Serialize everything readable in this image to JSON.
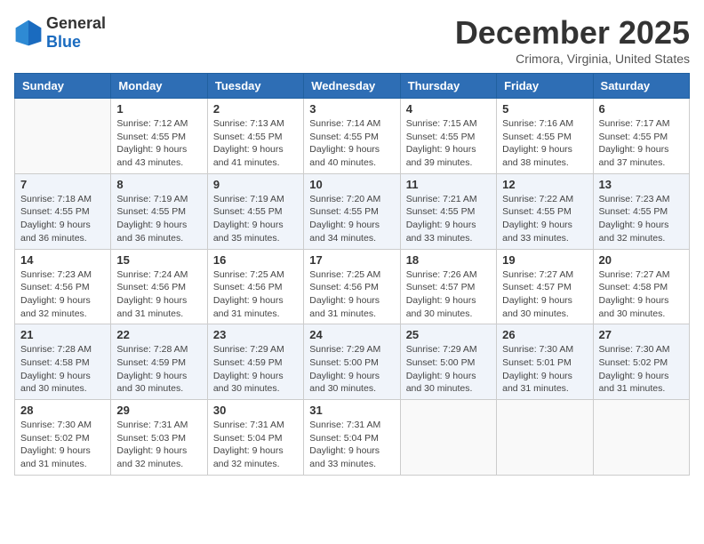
{
  "logo": {
    "text_general": "General",
    "text_blue": "Blue"
  },
  "header": {
    "month_title": "December 2025",
    "location": "Crimora, Virginia, United States"
  },
  "weekdays": [
    "Sunday",
    "Monday",
    "Tuesday",
    "Wednesday",
    "Thursday",
    "Friday",
    "Saturday"
  ],
  "weeks": [
    [
      {
        "day": "",
        "sunrise": "",
        "sunset": "",
        "daylight": ""
      },
      {
        "day": "1",
        "sunrise": "Sunrise: 7:12 AM",
        "sunset": "Sunset: 4:55 PM",
        "daylight": "Daylight: 9 hours and 43 minutes."
      },
      {
        "day": "2",
        "sunrise": "Sunrise: 7:13 AM",
        "sunset": "Sunset: 4:55 PM",
        "daylight": "Daylight: 9 hours and 41 minutes."
      },
      {
        "day": "3",
        "sunrise": "Sunrise: 7:14 AM",
        "sunset": "Sunset: 4:55 PM",
        "daylight": "Daylight: 9 hours and 40 minutes."
      },
      {
        "day": "4",
        "sunrise": "Sunrise: 7:15 AM",
        "sunset": "Sunset: 4:55 PM",
        "daylight": "Daylight: 9 hours and 39 minutes."
      },
      {
        "day": "5",
        "sunrise": "Sunrise: 7:16 AM",
        "sunset": "Sunset: 4:55 PM",
        "daylight": "Daylight: 9 hours and 38 minutes."
      },
      {
        "day": "6",
        "sunrise": "Sunrise: 7:17 AM",
        "sunset": "Sunset: 4:55 PM",
        "daylight": "Daylight: 9 hours and 37 minutes."
      }
    ],
    [
      {
        "day": "7",
        "sunrise": "Sunrise: 7:18 AM",
        "sunset": "Sunset: 4:55 PM",
        "daylight": "Daylight: 9 hours and 36 minutes."
      },
      {
        "day": "8",
        "sunrise": "Sunrise: 7:19 AM",
        "sunset": "Sunset: 4:55 PM",
        "daylight": "Daylight: 9 hours and 36 minutes."
      },
      {
        "day": "9",
        "sunrise": "Sunrise: 7:19 AM",
        "sunset": "Sunset: 4:55 PM",
        "daylight": "Daylight: 9 hours and 35 minutes."
      },
      {
        "day": "10",
        "sunrise": "Sunrise: 7:20 AM",
        "sunset": "Sunset: 4:55 PM",
        "daylight": "Daylight: 9 hours and 34 minutes."
      },
      {
        "day": "11",
        "sunrise": "Sunrise: 7:21 AM",
        "sunset": "Sunset: 4:55 PM",
        "daylight": "Daylight: 9 hours and 33 minutes."
      },
      {
        "day": "12",
        "sunrise": "Sunrise: 7:22 AM",
        "sunset": "Sunset: 4:55 PM",
        "daylight": "Daylight: 9 hours and 33 minutes."
      },
      {
        "day": "13",
        "sunrise": "Sunrise: 7:23 AM",
        "sunset": "Sunset: 4:55 PM",
        "daylight": "Daylight: 9 hours and 32 minutes."
      }
    ],
    [
      {
        "day": "14",
        "sunrise": "Sunrise: 7:23 AM",
        "sunset": "Sunset: 4:56 PM",
        "daylight": "Daylight: 9 hours and 32 minutes."
      },
      {
        "day": "15",
        "sunrise": "Sunrise: 7:24 AM",
        "sunset": "Sunset: 4:56 PM",
        "daylight": "Daylight: 9 hours and 31 minutes."
      },
      {
        "day": "16",
        "sunrise": "Sunrise: 7:25 AM",
        "sunset": "Sunset: 4:56 PM",
        "daylight": "Daylight: 9 hours and 31 minutes."
      },
      {
        "day": "17",
        "sunrise": "Sunrise: 7:25 AM",
        "sunset": "Sunset: 4:56 PM",
        "daylight": "Daylight: 9 hours and 31 minutes."
      },
      {
        "day": "18",
        "sunrise": "Sunrise: 7:26 AM",
        "sunset": "Sunset: 4:57 PM",
        "daylight": "Daylight: 9 hours and 30 minutes."
      },
      {
        "day": "19",
        "sunrise": "Sunrise: 7:27 AM",
        "sunset": "Sunset: 4:57 PM",
        "daylight": "Daylight: 9 hours and 30 minutes."
      },
      {
        "day": "20",
        "sunrise": "Sunrise: 7:27 AM",
        "sunset": "Sunset: 4:58 PM",
        "daylight": "Daylight: 9 hours and 30 minutes."
      }
    ],
    [
      {
        "day": "21",
        "sunrise": "Sunrise: 7:28 AM",
        "sunset": "Sunset: 4:58 PM",
        "daylight": "Daylight: 9 hours and 30 minutes."
      },
      {
        "day": "22",
        "sunrise": "Sunrise: 7:28 AM",
        "sunset": "Sunset: 4:59 PM",
        "daylight": "Daylight: 9 hours and 30 minutes."
      },
      {
        "day": "23",
        "sunrise": "Sunrise: 7:29 AM",
        "sunset": "Sunset: 4:59 PM",
        "daylight": "Daylight: 9 hours and 30 minutes."
      },
      {
        "day": "24",
        "sunrise": "Sunrise: 7:29 AM",
        "sunset": "Sunset: 5:00 PM",
        "daylight": "Daylight: 9 hours and 30 minutes."
      },
      {
        "day": "25",
        "sunrise": "Sunrise: 7:29 AM",
        "sunset": "Sunset: 5:00 PM",
        "daylight": "Daylight: 9 hours and 30 minutes."
      },
      {
        "day": "26",
        "sunrise": "Sunrise: 7:30 AM",
        "sunset": "Sunset: 5:01 PM",
        "daylight": "Daylight: 9 hours and 31 minutes."
      },
      {
        "day": "27",
        "sunrise": "Sunrise: 7:30 AM",
        "sunset": "Sunset: 5:02 PM",
        "daylight": "Daylight: 9 hours and 31 minutes."
      }
    ],
    [
      {
        "day": "28",
        "sunrise": "Sunrise: 7:30 AM",
        "sunset": "Sunset: 5:02 PM",
        "daylight": "Daylight: 9 hours and 31 minutes."
      },
      {
        "day": "29",
        "sunrise": "Sunrise: 7:31 AM",
        "sunset": "Sunset: 5:03 PM",
        "daylight": "Daylight: 9 hours and 32 minutes."
      },
      {
        "day": "30",
        "sunrise": "Sunrise: 7:31 AM",
        "sunset": "Sunset: 5:04 PM",
        "daylight": "Daylight: 9 hours and 32 minutes."
      },
      {
        "day": "31",
        "sunrise": "Sunrise: 7:31 AM",
        "sunset": "Sunset: 5:04 PM",
        "daylight": "Daylight: 9 hours and 33 minutes."
      },
      {
        "day": "",
        "sunrise": "",
        "sunset": "",
        "daylight": ""
      },
      {
        "day": "",
        "sunrise": "",
        "sunset": "",
        "daylight": ""
      },
      {
        "day": "",
        "sunrise": "",
        "sunset": "",
        "daylight": ""
      }
    ]
  ]
}
